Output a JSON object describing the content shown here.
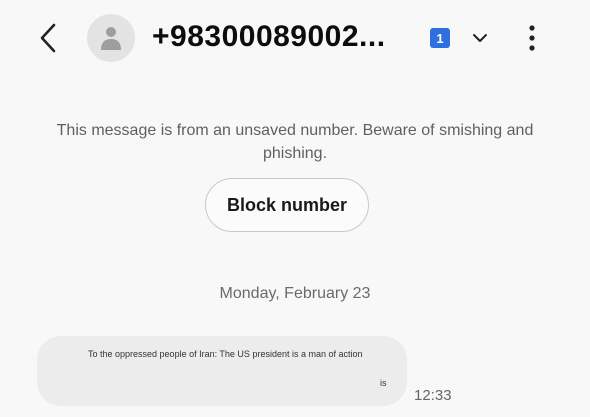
{
  "header": {
    "title": "+98300089002...",
    "sim_badge": "1",
    "icons": {
      "back": "chevron-left-icon",
      "avatar": "person-icon",
      "dropdown": "chevron-down-icon",
      "more": "more-vert-icon"
    }
  },
  "warning": {
    "text": "This message is from an unsaved number. Beware of smishing and phishing.",
    "block_button_label": "Block number"
  },
  "conversation": {
    "date_separator": "Monday, February 23",
    "messages": [
      {
        "line1": "To the oppressed people of Iran: The US president is a man of action",
        "line2": "is",
        "time": "12:33"
      }
    ]
  },
  "colors": {
    "accent": "#2f6fe0",
    "bubble": "#ececec",
    "background": "#f8f8f8"
  }
}
